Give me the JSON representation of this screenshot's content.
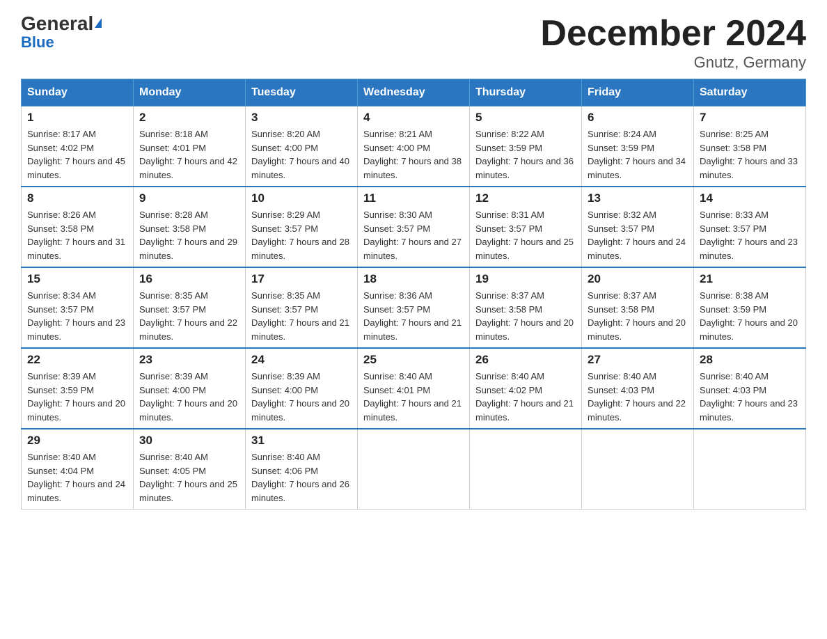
{
  "header": {
    "logo_general": "General",
    "logo_blue": "Blue",
    "title": "December 2024",
    "subtitle": "Gnutz, Germany"
  },
  "days_of_week": [
    "Sunday",
    "Monday",
    "Tuesday",
    "Wednesday",
    "Thursday",
    "Friday",
    "Saturday"
  ],
  "weeks": [
    [
      {
        "day": "1",
        "sunrise": "8:17 AM",
        "sunset": "4:02 PM",
        "daylight": "7 hours and 45 minutes."
      },
      {
        "day": "2",
        "sunrise": "8:18 AM",
        "sunset": "4:01 PM",
        "daylight": "7 hours and 42 minutes."
      },
      {
        "day": "3",
        "sunrise": "8:20 AM",
        "sunset": "4:00 PM",
        "daylight": "7 hours and 40 minutes."
      },
      {
        "day": "4",
        "sunrise": "8:21 AM",
        "sunset": "4:00 PM",
        "daylight": "7 hours and 38 minutes."
      },
      {
        "day": "5",
        "sunrise": "8:22 AM",
        "sunset": "3:59 PM",
        "daylight": "7 hours and 36 minutes."
      },
      {
        "day": "6",
        "sunrise": "8:24 AM",
        "sunset": "3:59 PM",
        "daylight": "7 hours and 34 minutes."
      },
      {
        "day": "7",
        "sunrise": "8:25 AM",
        "sunset": "3:58 PM",
        "daylight": "7 hours and 33 minutes."
      }
    ],
    [
      {
        "day": "8",
        "sunrise": "8:26 AM",
        "sunset": "3:58 PM",
        "daylight": "7 hours and 31 minutes."
      },
      {
        "day": "9",
        "sunrise": "8:28 AM",
        "sunset": "3:58 PM",
        "daylight": "7 hours and 29 minutes."
      },
      {
        "day": "10",
        "sunrise": "8:29 AM",
        "sunset": "3:57 PM",
        "daylight": "7 hours and 28 minutes."
      },
      {
        "day": "11",
        "sunrise": "8:30 AM",
        "sunset": "3:57 PM",
        "daylight": "7 hours and 27 minutes."
      },
      {
        "day": "12",
        "sunrise": "8:31 AM",
        "sunset": "3:57 PM",
        "daylight": "7 hours and 25 minutes."
      },
      {
        "day": "13",
        "sunrise": "8:32 AM",
        "sunset": "3:57 PM",
        "daylight": "7 hours and 24 minutes."
      },
      {
        "day": "14",
        "sunrise": "8:33 AM",
        "sunset": "3:57 PM",
        "daylight": "7 hours and 23 minutes."
      }
    ],
    [
      {
        "day": "15",
        "sunrise": "8:34 AM",
        "sunset": "3:57 PM",
        "daylight": "7 hours and 23 minutes."
      },
      {
        "day": "16",
        "sunrise": "8:35 AM",
        "sunset": "3:57 PM",
        "daylight": "7 hours and 22 minutes."
      },
      {
        "day": "17",
        "sunrise": "8:35 AM",
        "sunset": "3:57 PM",
        "daylight": "7 hours and 21 minutes."
      },
      {
        "day": "18",
        "sunrise": "8:36 AM",
        "sunset": "3:57 PM",
        "daylight": "7 hours and 21 minutes."
      },
      {
        "day": "19",
        "sunrise": "8:37 AM",
        "sunset": "3:58 PM",
        "daylight": "7 hours and 20 minutes."
      },
      {
        "day": "20",
        "sunrise": "8:37 AM",
        "sunset": "3:58 PM",
        "daylight": "7 hours and 20 minutes."
      },
      {
        "day": "21",
        "sunrise": "8:38 AM",
        "sunset": "3:59 PM",
        "daylight": "7 hours and 20 minutes."
      }
    ],
    [
      {
        "day": "22",
        "sunrise": "8:39 AM",
        "sunset": "3:59 PM",
        "daylight": "7 hours and 20 minutes."
      },
      {
        "day": "23",
        "sunrise": "8:39 AM",
        "sunset": "4:00 PM",
        "daylight": "7 hours and 20 minutes."
      },
      {
        "day": "24",
        "sunrise": "8:39 AM",
        "sunset": "4:00 PM",
        "daylight": "7 hours and 20 minutes."
      },
      {
        "day": "25",
        "sunrise": "8:40 AM",
        "sunset": "4:01 PM",
        "daylight": "7 hours and 21 minutes."
      },
      {
        "day": "26",
        "sunrise": "8:40 AM",
        "sunset": "4:02 PM",
        "daylight": "7 hours and 21 minutes."
      },
      {
        "day": "27",
        "sunrise": "8:40 AM",
        "sunset": "4:03 PM",
        "daylight": "7 hours and 22 minutes."
      },
      {
        "day": "28",
        "sunrise": "8:40 AM",
        "sunset": "4:03 PM",
        "daylight": "7 hours and 23 minutes."
      }
    ],
    [
      {
        "day": "29",
        "sunrise": "8:40 AM",
        "sunset": "4:04 PM",
        "daylight": "7 hours and 24 minutes."
      },
      {
        "day": "30",
        "sunrise": "8:40 AM",
        "sunset": "4:05 PM",
        "daylight": "7 hours and 25 minutes."
      },
      {
        "day": "31",
        "sunrise": "8:40 AM",
        "sunset": "4:06 PM",
        "daylight": "7 hours and 26 minutes."
      },
      null,
      null,
      null,
      null
    ]
  ]
}
